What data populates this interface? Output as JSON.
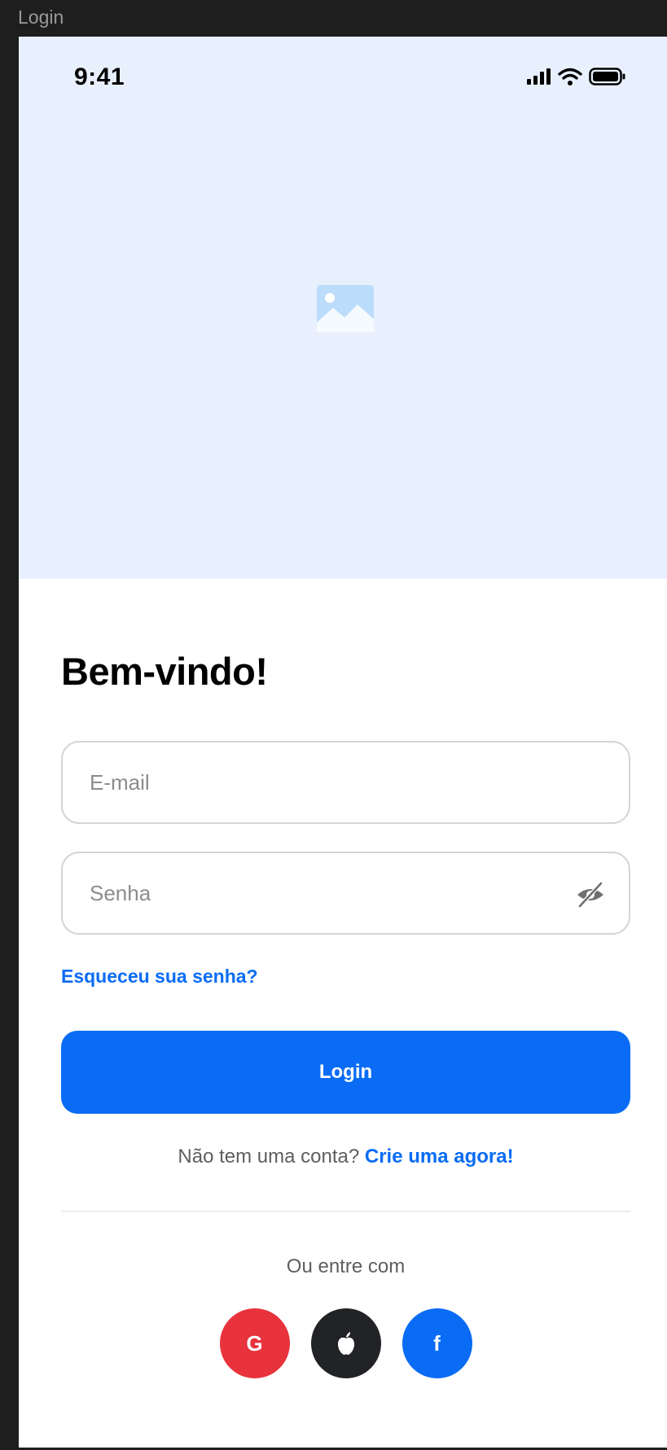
{
  "frame": {
    "label": "Login"
  },
  "status_bar": {
    "time": "9:41"
  },
  "login": {
    "title": "Bem-vindo!",
    "email_placeholder": "E-mail",
    "password_placeholder": "Senha",
    "forgot_password": "Esqueceu sua senha?",
    "login_button": "Login",
    "no_account_text": "Não tem uma conta?",
    "create_account_link": "Crie uma agora!",
    "alternative_label": "Ou entre com"
  },
  "social": {
    "google": {
      "label": "G",
      "color": "#e8323c",
      "icon": "google-icon"
    },
    "apple": {
      "label": "",
      "color": "#222326",
      "icon": "apple-icon"
    },
    "facebook": {
      "label": "f",
      "color": "#0a6cf5",
      "icon": "facebook-icon"
    }
  },
  "colors": {
    "primary": "#0a6cf5",
    "hero_background": "#e8f0fe",
    "input_border": "#d4d4d8"
  }
}
